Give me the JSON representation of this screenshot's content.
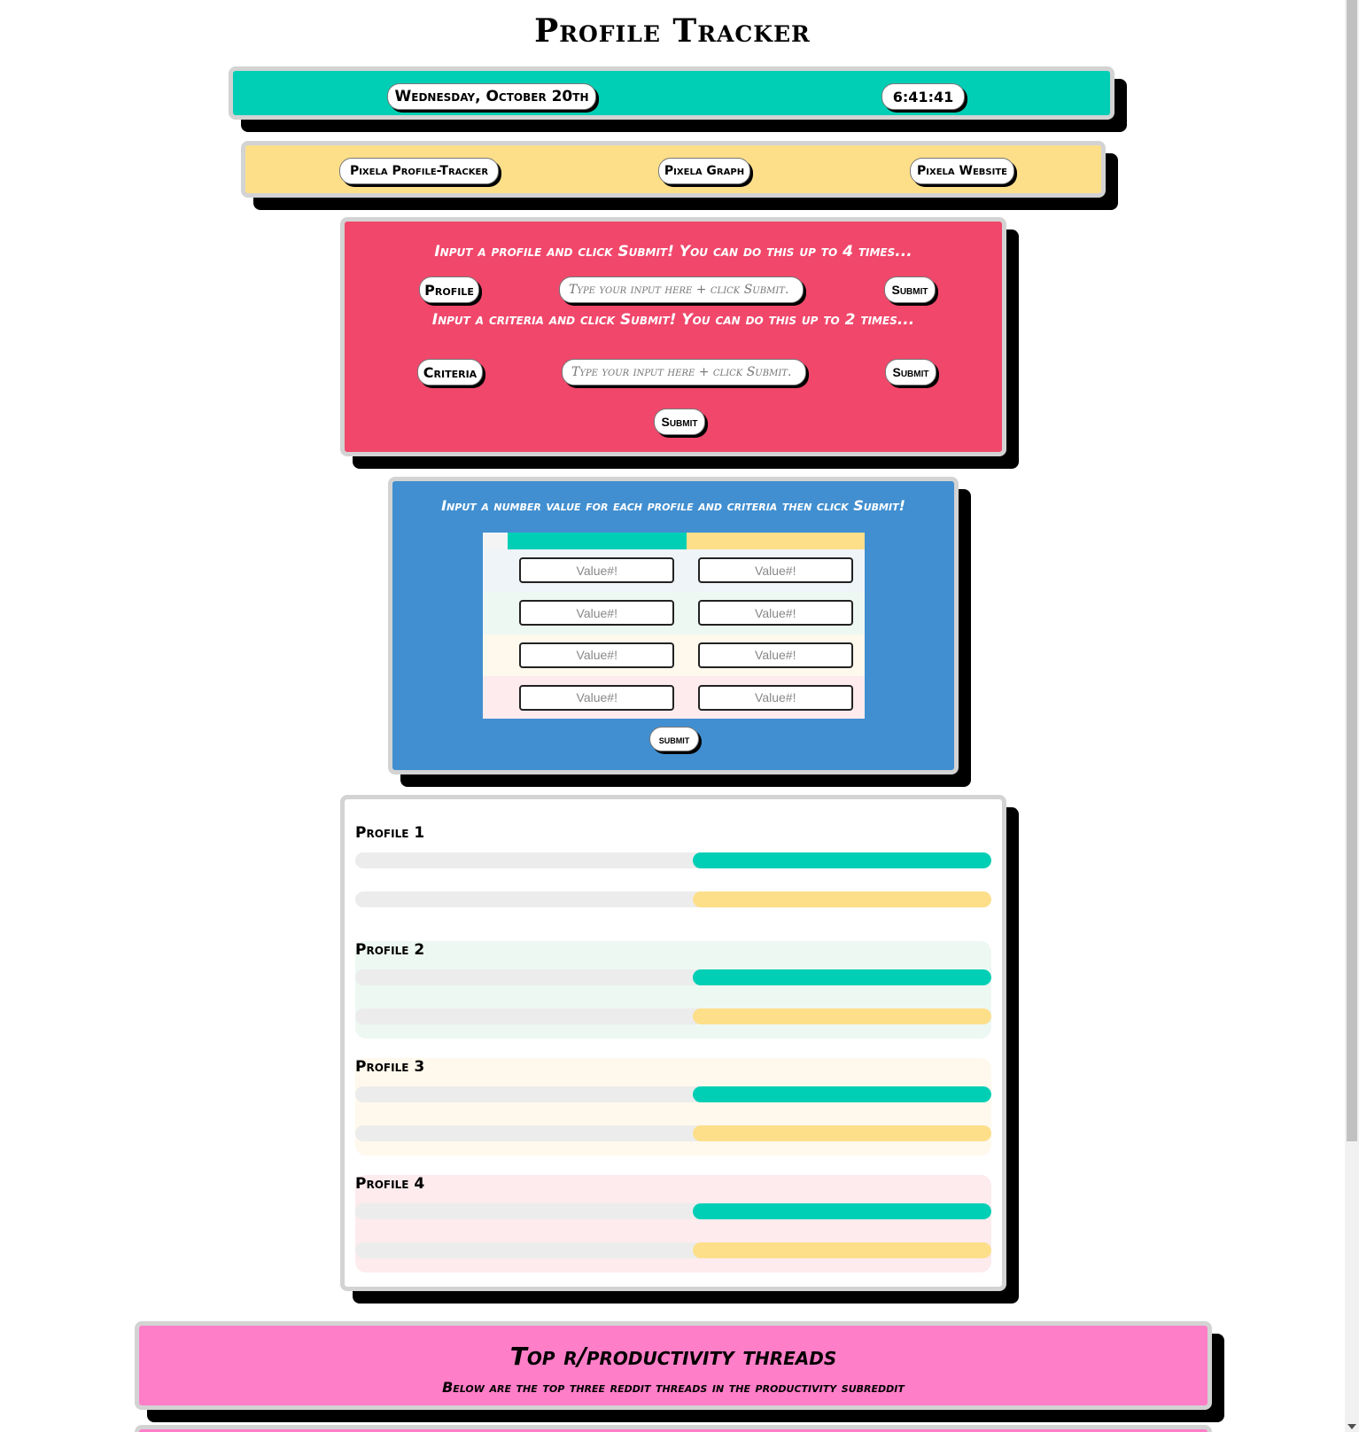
{
  "page": {
    "title": "Profile Tracker"
  },
  "date_bar": {
    "date": "Wednesday, October 20th",
    "time": "6:41:41",
    "color": "#00cfb5"
  },
  "links_bar": {
    "color": "#fddf8a",
    "links": [
      {
        "label": "Pixela Profile-Tracker"
      },
      {
        "label": "Pixela Graph"
      },
      {
        "label": "Pixela Website"
      }
    ]
  },
  "input_card": {
    "color": "#f0476b",
    "profile_instruction": "Input a profile and click Submit! You can do this up to 4 times...",
    "profile_label": "Profile",
    "profile_placeholder": "Type your input here + click Submit.",
    "profile_submit": "Submit",
    "criteria_instruction": "Input a criteria and click Submit! You can do this up to 2 times...",
    "criteria_label": "Criteria",
    "criteria_placeholder": "Type your input here + click Submit.",
    "criteria_submit": "Submit",
    "main_submit": "Submit"
  },
  "value_card": {
    "color": "#418fd0",
    "instruction": "Input a number value for each profile and criteria then click Submit!",
    "value_placeholder": "Value#!",
    "submit": "submit",
    "rows": 4,
    "columns": 2
  },
  "bars_card": {
    "profiles": [
      {
        "name": "Profile 1",
        "bars": [
          {
            "fill": 0.47,
            "color": "teal"
          },
          {
            "fill": 0.47,
            "color": "yellow"
          }
        ]
      },
      {
        "name": "Profile 2",
        "bars": [
          {
            "fill": 0.47,
            "color": "teal"
          },
          {
            "fill": 0.47,
            "color": "yellow"
          }
        ]
      },
      {
        "name": "Profile 3",
        "bars": [
          {
            "fill": 0.47,
            "color": "teal"
          },
          {
            "fill": 0.47,
            "color": "yellow"
          }
        ]
      },
      {
        "name": "Profile 4",
        "bars": [
          {
            "fill": 0.47,
            "color": "teal"
          },
          {
            "fill": 0.47,
            "color": "yellow"
          }
        ]
      }
    ],
    "row_tints": [
      "#ffffff",
      "#eef8f2",
      "#fef9ec",
      "#fdebee"
    ]
  },
  "reddit_card": {
    "color": "#ff7ec8",
    "title": "Top r/productivity threads",
    "subtitle": "Below are the top three reddit threads in the productivity subreddit"
  }
}
